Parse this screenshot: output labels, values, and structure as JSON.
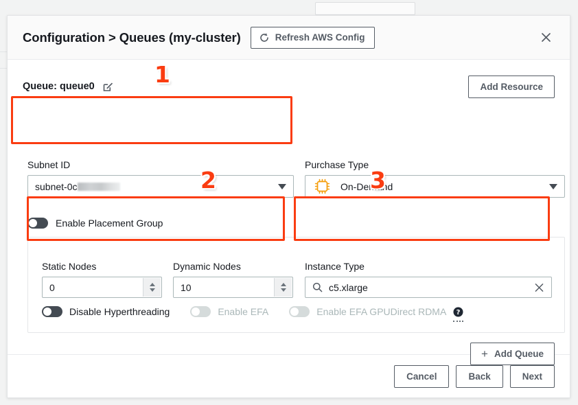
{
  "header": {
    "title": "Configuration > Queues (my-cluster)",
    "refresh_button": "Refresh AWS Config",
    "refresh_icon": "refresh-icon",
    "close_icon": "close-icon"
  },
  "queue": {
    "label": "Queue: queue0",
    "edit_icon": "edit-icon",
    "add_resource_button": "Add Resource"
  },
  "fields": {
    "subnet": {
      "label": "Subnet ID",
      "value_prefix": "subnet-0c",
      "value_redacted": true,
      "caret_icon": "chevron-down-icon"
    },
    "purchase_type": {
      "label": "Purchase Type",
      "value": "On-Demand",
      "icon": "cpu-chip-icon",
      "icon_color": "#f59d0a",
      "caret_icon": "chevron-down-icon"
    },
    "static_nodes": {
      "label": "Static Nodes",
      "value": "0"
    },
    "dynamic_nodes": {
      "label": "Dynamic Nodes",
      "value": "10"
    },
    "instance_type": {
      "label": "Instance Type",
      "value": "c5.xlarge",
      "search_icon": "search-icon",
      "clear_icon": "clear-x-icon"
    }
  },
  "toggles": {
    "placement_group": {
      "label": "Enable Placement Group",
      "state": "off",
      "disabled": false
    },
    "disable_hyperthreading": {
      "label": "Disable Hyperthreading",
      "state": "off",
      "disabled": false
    },
    "enable_efa": {
      "label": "Enable EFA",
      "state": "off",
      "disabled": true
    },
    "enable_efa_gpudirect": {
      "label": "Enable EFA GPUDirect RDMA",
      "state": "off",
      "disabled": true
    },
    "help_icon": "question-mark-help-icon"
  },
  "add_queue_button": {
    "label": "Add Queue",
    "icon": "plus-icon"
  },
  "footer": {
    "cancel": "Cancel",
    "back": "Back",
    "next": "Next"
  },
  "annotations": {
    "one": "1",
    "two": "2",
    "three": "3",
    "color": "#fa3c11"
  }
}
